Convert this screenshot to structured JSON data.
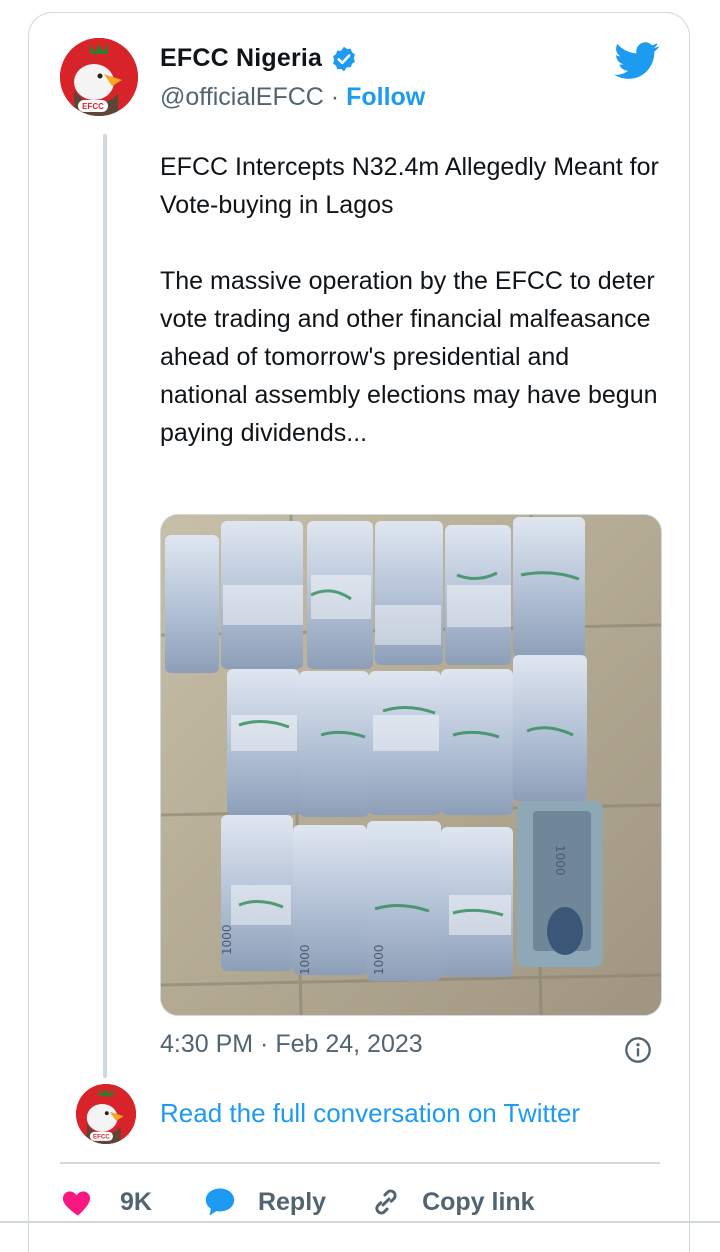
{
  "author": {
    "name": "EFCC Nigeria",
    "handle": "@officialEFCC",
    "separator": "·",
    "follow_label": "Follow",
    "avatar_text": "EFCC"
  },
  "tweet": {
    "headline": "EFCC Intercepts N32.4m Allegedly Meant for Vote-buying in Lagos",
    "body": "The massive operation by the EFCC to deter vote trading and other financial malfeasance ahead of tomorrow's presidential and national assembly elections may have begun paying dividends...",
    "timestamp": "4:30 PM · Feb 24, 2023",
    "photo_label": "1000"
  },
  "footer": {
    "read_full": "Read the full conversation on Twitter",
    "likes": "9K",
    "reply_label": "Reply",
    "copy_label": "Copy link"
  },
  "icons": {
    "verified": "verified-badge-icon",
    "brand": "twitter-bird-icon",
    "info": "info-icon",
    "like": "heart-icon",
    "reply": "speech-bubble-icon",
    "copy": "link-icon"
  },
  "colors": {
    "accent": "#1d9bf0",
    "like": "#f91880",
    "muted": "#536471",
    "avatar_red": "#d8232a"
  }
}
